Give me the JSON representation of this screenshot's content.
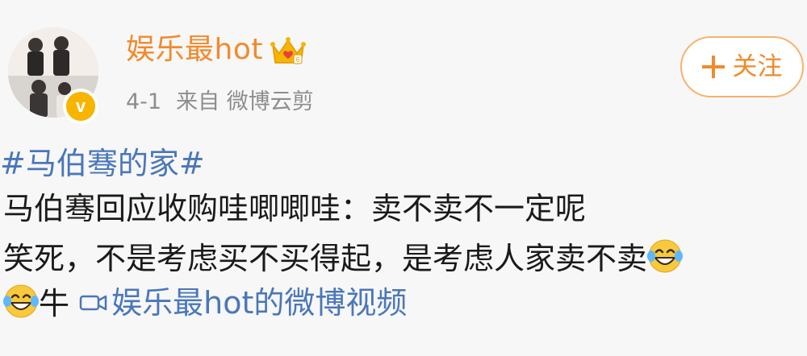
{
  "post": {
    "author": {
      "name": "娱乐最hot",
      "verified": true,
      "crown_badge": true
    },
    "meta": {
      "date": "4-1",
      "source": "来自 微博云剪"
    },
    "follow_button": {
      "label": "关注"
    },
    "hashtag": "#马伯骞的家#",
    "lines": [
      "马伯骞回应收购哇唧唧哇：卖不卖不一定呢",
      "笑死，不是考虑买不买得起，是考虑人家卖不卖",
      "牛"
    ],
    "video_link": {
      "label": "娱乐最hot的微博视频"
    }
  },
  "colors": {
    "username": "#f18a2c",
    "link": "#4a77b9",
    "meta": "#8d8d8d",
    "follow_border": "#f6b36b",
    "background": "#f7f7f7"
  }
}
